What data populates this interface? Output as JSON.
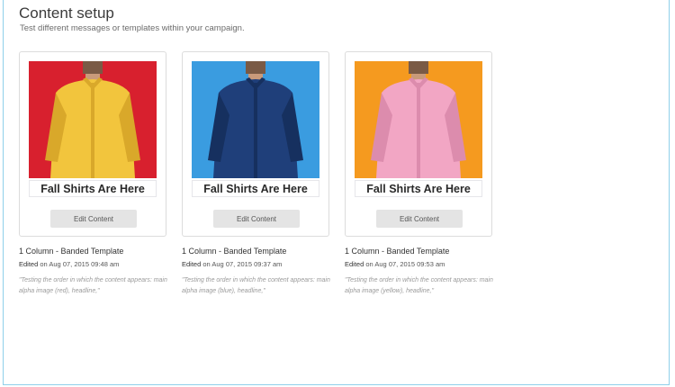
{
  "page": {
    "title": "Content setup",
    "subtitle": "Test different messages or templates within your campaign."
  },
  "variants": [
    {
      "photo_bg": "#d8202e",
      "shirt_color": "#f2c53d",
      "shirt_shade": "#d9a82a",
      "headline": "Fall Shirts Are Here",
      "edit_label": "Edit Content",
      "template": "1 Column - Banded Template",
      "edited_label": "Edited",
      "edited_date": "on Aug 07, 2015 09:48 am",
      "note": "\"Testing the order in which the content appears: main alpha image (red), headline,\""
    },
    {
      "photo_bg": "#3a9ce0",
      "shirt_color": "#1f3f7a",
      "shirt_shade": "#16305f",
      "headline": "Fall Shirts Are Here",
      "edit_label": "Edit Content",
      "template": "1 Column - Banded Template",
      "edited_label": "Edited",
      "edited_date": "on Aug 07, 2015 09:37 am",
      "note": "\"Testing the order in which the content appears: main alpha image (blue), headline,\""
    },
    {
      "photo_bg": "#f59a1f",
      "shirt_color": "#f2a6c4",
      "shirt_shade": "#dc8cad",
      "headline": "Fall Shirts Are Here",
      "edit_label": "Edit Content",
      "template": "1 Column - Banded Template",
      "edited_label": "Edited",
      "edited_date": "on Aug 07, 2015 09:53 am",
      "note": "\"Testing the order in which the content appears: main alpha image (yellow), headline,\""
    }
  ]
}
